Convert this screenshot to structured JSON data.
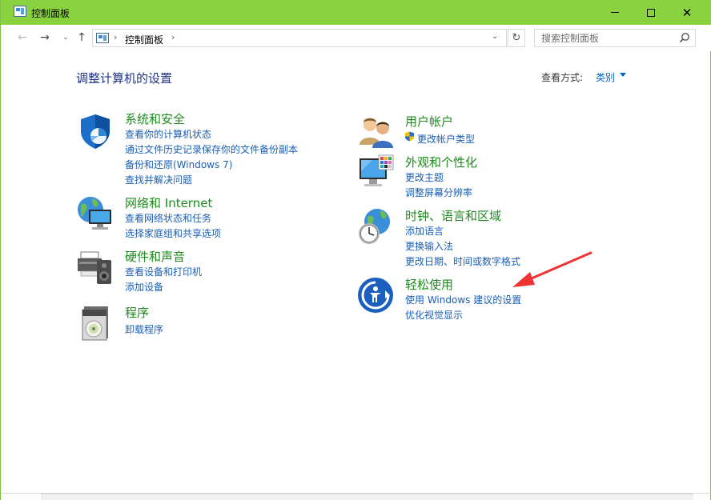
{
  "window": {
    "title": "控制面板",
    "minimize_label": "",
    "close_glyph": "✕"
  },
  "nav": {
    "back_glyph": "←",
    "forward_glyph": "→",
    "recent_glyph": "⌄",
    "up_glyph": "↑",
    "breadcrumb_sep": "›",
    "breadcrumb": "控制面板",
    "dropdown_glyph": "⌄",
    "refresh_glyph": "↻",
    "search_placeholder": "搜索控制面板"
  },
  "main": {
    "title": "调整计算机的设置",
    "view_by_label": "查看方式:",
    "view_by_value": "类别"
  },
  "left_column": [
    {
      "title": "系统和安全",
      "icon": "shield-icon",
      "links": [
        "查看你的计算机状态",
        "通过文件历史记录保存你的文件备份副本",
        "备份和还原(Windows 7)",
        "查找并解决问题"
      ]
    },
    {
      "title": "网络和 Internet",
      "icon": "network-globe-icon",
      "links": [
        "查看网络状态和任务",
        "选择家庭组和共享选项"
      ]
    },
    {
      "title": "硬件和声音",
      "icon": "printer-speaker-icon",
      "links": [
        "查看设备和打印机",
        "添加设备"
      ]
    },
    {
      "title": "程序",
      "icon": "programs-disc-icon",
      "links": [
        "卸载程序"
      ]
    }
  ],
  "right_column": [
    {
      "title": "用户帐户",
      "icon": "users-icon",
      "links": [
        "更改帐户类型"
      ],
      "link_icon": "uac-shield-icon"
    },
    {
      "title": "外观和个性化",
      "icon": "monitor-palette-icon",
      "links": [
        "更改主题",
        "调整屏幕分辨率"
      ]
    },
    {
      "title": "时钟、语言和区域",
      "icon": "clock-globe-icon",
      "links": [
        "添加语言",
        "更换输入法",
        "更改日期、时间或数字格式"
      ]
    },
    {
      "title": "轻松使用",
      "icon": "ease-of-access-icon",
      "links": [
        "使用 Windows 建议的设置",
        "优化视觉显示"
      ]
    }
  ],
  "annotation": {
    "arrow_color": "#ee3333"
  },
  "colors": {
    "titlebar": "#8ad23f",
    "category_title": "#1c8b1c",
    "link": "#1a5fb4",
    "page_title": "#1e3287"
  }
}
